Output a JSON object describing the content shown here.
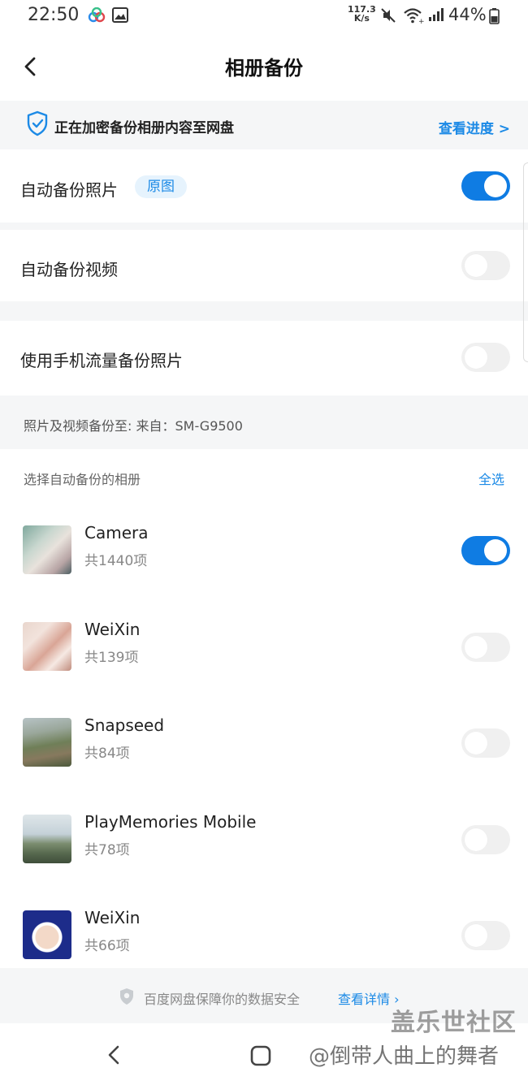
{
  "status_bar": {
    "time": "22:50",
    "speed_value": "117.3",
    "speed_unit": "K/s",
    "battery": "44%"
  },
  "header": {
    "title": "相册备份"
  },
  "notice": {
    "text": "正在加密备份相册内容至网盘",
    "link": "查看进度 >"
  },
  "settings": {
    "auto_photo": {
      "label": "自动备份照片",
      "tag": "原图",
      "enabled": true
    },
    "auto_video": {
      "label": "自动备份视频",
      "enabled": false
    },
    "mobile_data": {
      "label": "使用手机流量备份照片",
      "enabled": false
    }
  },
  "backup_target": "照片及视频备份至: 来自：SM-G9500",
  "album_section": {
    "label": "选择自动备份的相册",
    "select_all": "全选"
  },
  "albums": [
    {
      "name": "Camera",
      "count": "共1440项",
      "enabled": true
    },
    {
      "name": "WeiXin",
      "count": "共139项",
      "enabled": false
    },
    {
      "name": "Snapseed",
      "count": "共84项",
      "enabled": false
    },
    {
      "name": "PlayMemories Mobile",
      "count": "共78项",
      "enabled": false
    },
    {
      "name": "WeiXin",
      "count": "共66项",
      "enabled": false
    }
  ],
  "footer": {
    "text": "百度网盘保障你的数据安全",
    "link": "查看详情 ›"
  },
  "watermark": {
    "site": "盖乐世社区",
    "author": "@倒带人曲上的舞者"
  },
  "colors": {
    "accent": "#0f7ce3",
    "link": "#1c8ae6"
  }
}
